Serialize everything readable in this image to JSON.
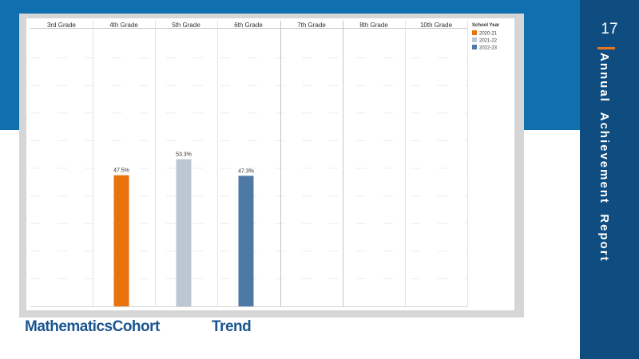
{
  "page": {
    "number": "17",
    "side_title": "Annual  Achievement  Report",
    "caption_left": "MathematicsCohort",
    "caption_right": "Trend"
  },
  "colors": {
    "top_band": "#1070af",
    "side_panel": "#0f4d80",
    "accent": "#e87722",
    "caption": "#1a5590"
  },
  "chart_data": {
    "type": "bar",
    "categories": [
      "3rd Grade",
      "4th Grade",
      "5th Grade",
      "6th Grade",
      "7th Grade",
      "8th Grade",
      "10th Grade"
    ],
    "legend": {
      "title": "School Year",
      "placement": "top-right"
    },
    "series": [
      {
        "name": "2020-21",
        "color": "#e8720c",
        "values": [
          null,
          47.5,
          null,
          null,
          null,
          null,
          null
        ],
        "labels": [
          null,
          "47.5%",
          null,
          null,
          null,
          null,
          null
        ]
      },
      {
        "name": "2021-22",
        "color": "#bcc7d3",
        "values": [
          null,
          null,
          53.3,
          null,
          null,
          null,
          null
        ],
        "labels": [
          null,
          null,
          "53.3%",
          null,
          null,
          null,
          null
        ]
      },
      {
        "name": "2022-23",
        "color": "#4e79a7",
        "values": [
          null,
          null,
          null,
          47.3,
          null,
          null,
          null
        ],
        "labels": [
          null,
          null,
          null,
          "47.3%",
          null,
          null,
          null
        ]
      }
    ],
    "ylim": [
      0,
      100
    ],
    "grid": true
  }
}
